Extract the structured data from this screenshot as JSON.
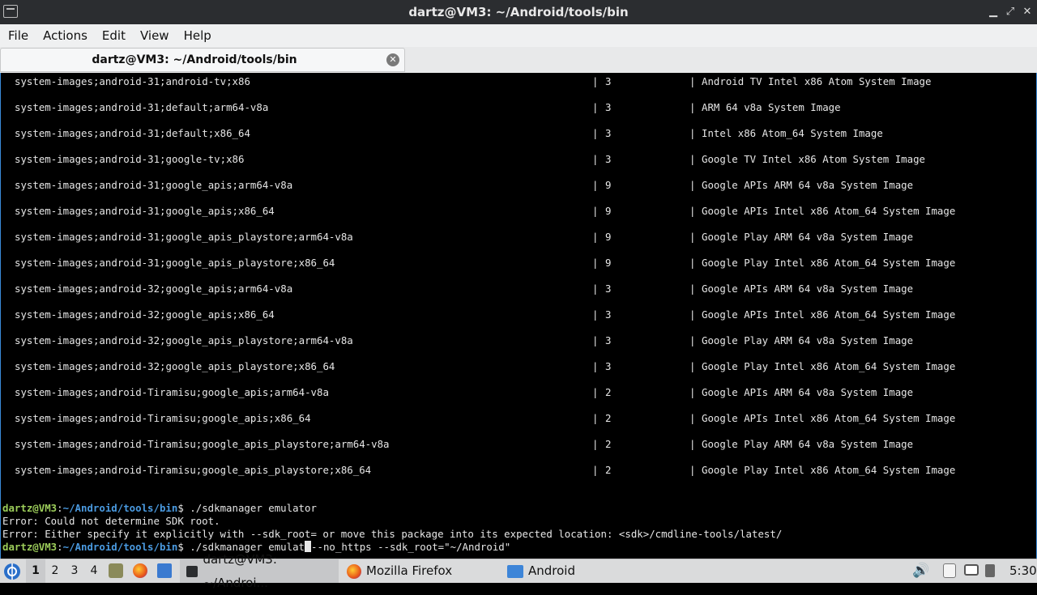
{
  "window": {
    "title": "dartz@VM3: ~/Android/tools/bin"
  },
  "menu": [
    "File",
    "Actions",
    "Edit",
    "View",
    "Help"
  ],
  "tab": {
    "label": "dartz@VM3: ~/Android/tools/bin",
    "close_glyph": "✕"
  },
  "table": {
    "separator": "|",
    "rows": [
      {
        "pkg": "system-images;android-31;android-tv;x86",
        "ver": "3",
        "desc": "Android TV Intel x86 Atom System Image"
      },
      {
        "pkg": "system-images;android-31;default;arm64-v8a",
        "ver": "3",
        "desc": "ARM 64 v8a System Image"
      },
      {
        "pkg": "system-images;android-31;default;x86_64",
        "ver": "3",
        "desc": "Intel x86 Atom_64 System Image"
      },
      {
        "pkg": "system-images;android-31;google-tv;x86",
        "ver": "3",
        "desc": "Google TV Intel x86 Atom System Image"
      },
      {
        "pkg": "system-images;android-31;google_apis;arm64-v8a",
        "ver": "9",
        "desc": "Google APIs ARM 64 v8a System Image"
      },
      {
        "pkg": "system-images;android-31;google_apis;x86_64",
        "ver": "9",
        "desc": "Google APIs Intel x86 Atom_64 System Image"
      },
      {
        "pkg": "system-images;android-31;google_apis_playstore;arm64-v8a",
        "ver": "9",
        "desc": "Google Play ARM 64 v8a System Image"
      },
      {
        "pkg": "system-images;android-31;google_apis_playstore;x86_64",
        "ver": "9",
        "desc": "Google Play Intel x86 Atom_64 System Image"
      },
      {
        "pkg": "system-images;android-32;google_apis;arm64-v8a",
        "ver": "3",
        "desc": "Google APIs ARM 64 v8a System Image"
      },
      {
        "pkg": "system-images;android-32;google_apis;x86_64",
        "ver": "3",
        "desc": "Google APIs Intel x86 Atom_64 System Image"
      },
      {
        "pkg": "system-images;android-32;google_apis_playstore;arm64-v8a",
        "ver": "3",
        "desc": "Google Play ARM 64 v8a System Image"
      },
      {
        "pkg": "system-images;android-32;google_apis_playstore;x86_64",
        "ver": "3",
        "desc": "Google Play Intel x86 Atom_64 System Image"
      },
      {
        "pkg": "system-images;android-Tiramisu;google_apis;arm64-v8a",
        "ver": "2",
        "desc": "Google APIs ARM 64 v8a System Image"
      },
      {
        "pkg": "system-images;android-Tiramisu;google_apis;x86_64",
        "ver": "2",
        "desc": "Google APIs Intel x86 Atom_64 System Image"
      },
      {
        "pkg": "system-images;android-Tiramisu;google_apis_playstore;arm64-v8a",
        "ver": "2",
        "desc": "Google Play ARM 64 v8a System Image"
      },
      {
        "pkg": "system-images;android-Tiramisu;google_apis_playstore;x86_64",
        "ver": "2",
        "desc": "Google Play Intel x86 Atom_64 System Image"
      }
    ]
  },
  "console": {
    "prompt_user": "dartz@VM3",
    "prompt_sep": ":",
    "prompt_path": "~/Android/tools/bin",
    "prompt_dollar": "$ ",
    "cmd1": "./sdkmanager emulator",
    "error1": "Error: Could not determine SDK root.",
    "error2": "Error: Either specify it explicitly with --sdk_root= or move this package into its expected location: <sdk>/cmdline-tools/latest/",
    "cmd2_before": "./sdkmanager emulat",
    "cmd2_after": "--no_https --sdk_root=\"~/Android\""
  },
  "taskbar": {
    "workspaces": [
      "1",
      "2",
      "3",
      "4"
    ],
    "tasks": [
      {
        "label": "dartz@VM3: ~/Androi...",
        "icon": "terminal-icon"
      },
      {
        "label": "Mozilla Firefox",
        "icon": "firefox-icon"
      },
      {
        "label": "Android",
        "icon": "folder-icon"
      }
    ],
    "clock": "5:30"
  },
  "colors": {
    "prompt_user": "#9ccd5a",
    "prompt_path": "#4a9ae0",
    "terminal_bg": "#000000",
    "title_bg": "#2b2d30"
  }
}
